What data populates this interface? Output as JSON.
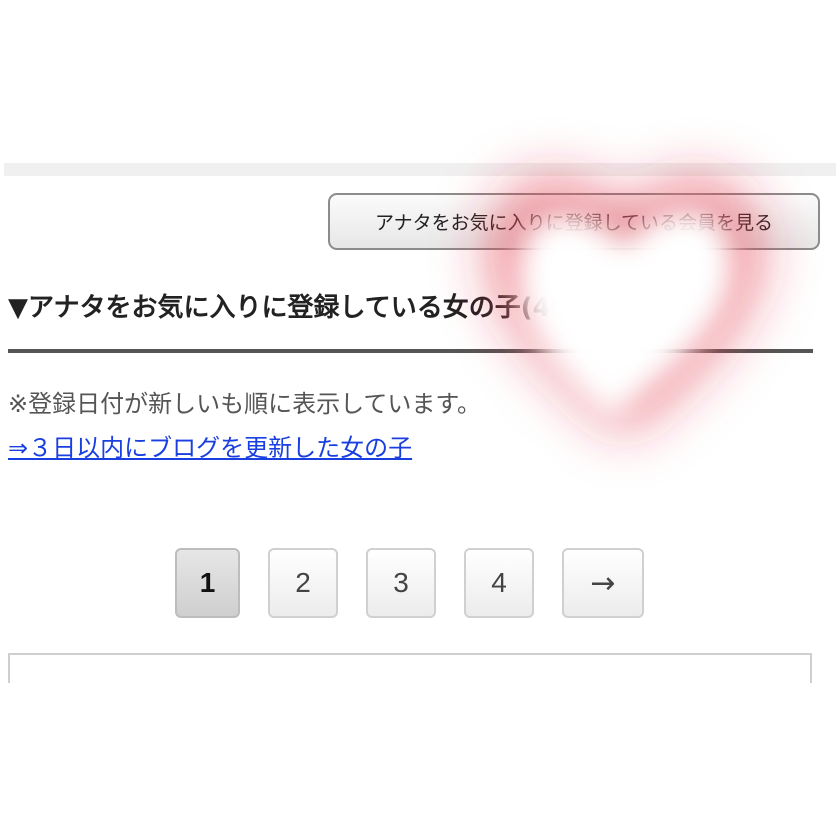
{
  "header": {
    "view_favorited_by_button": "アナタをお気に入りに登録している会員を見る"
  },
  "section": {
    "title": "▼アナタをお気に入りに登録している女の子(400人)",
    "sort_note": "※登録日付が新しいも順に表示しています。",
    "recent_blog_link": "⇒３日以内にブログを更新した女の子"
  },
  "pagination": {
    "current_page": "1",
    "pages": [
      "1",
      "2",
      "3",
      "4"
    ],
    "next_label": "→"
  },
  "colors": {
    "link": "#1a3fe0",
    "heart_glow": "#e0283c",
    "rule": "#555555"
  },
  "overlay": {
    "icon": "heart-icon"
  }
}
